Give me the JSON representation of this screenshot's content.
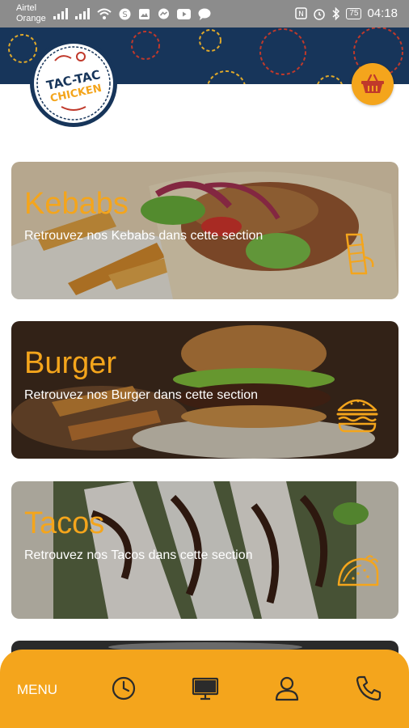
{
  "status_bar": {
    "carrier_line1": "Airtel",
    "carrier_line2": "Orange",
    "battery": "75",
    "time": "04:18",
    "icons": [
      "signal-icon",
      "wifi-icon",
      "skype-icon",
      "gallery-icon",
      "messenger-icon",
      "youtube-icon",
      "message-icon",
      "nfc-icon",
      "alarm-icon",
      "bluetooth-icon"
    ]
  },
  "header": {
    "logo_text_line1": "TAC-TAC",
    "logo_text_line2": "CHICKEN",
    "brand_blue": "#17355a",
    "accent_orange": "#f4a51c"
  },
  "categories": [
    {
      "title": "Kebabs",
      "subtitle": "Retrouvez nos Kebabs dans cette section",
      "icon": "kebab-icon"
    },
    {
      "title": "Burger",
      "subtitle": "Retrouvez nos Burger dans cette section",
      "icon": "burger-icon"
    },
    {
      "title": "Tacos",
      "subtitle": "Retrouvez nos Tacos dans cette section",
      "icon": "taco-icon"
    }
  ],
  "bottom_nav": {
    "menu_label": "MENU",
    "icons": [
      "clock-icon",
      "monitor-icon",
      "user-icon",
      "phone-icon"
    ]
  }
}
